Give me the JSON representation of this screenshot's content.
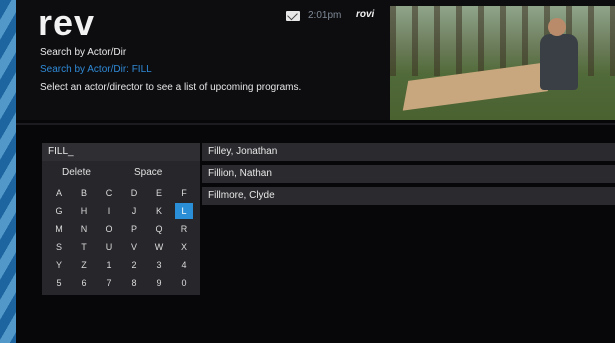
{
  "header": {
    "logo": "rev",
    "time": "2:01pm",
    "brand": "rovi"
  },
  "page": {
    "title": "Search by Actor/Dir",
    "subtitle": "Search by Actor/Dir: FILL",
    "instructions": "Select an actor/director to see a list of upcoming programs."
  },
  "keyboard": {
    "input_value": "FILL_",
    "delete_label": "Delete",
    "space_label": "Space",
    "selected_key": "L",
    "rows": [
      [
        "A",
        "B",
        "C",
        "D",
        "E",
        "F"
      ],
      [
        "G",
        "H",
        "I",
        "J",
        "K",
        "L"
      ],
      [
        "M",
        "N",
        "O",
        "P",
        "Q",
        "R"
      ],
      [
        "S",
        "T",
        "U",
        "V",
        "W",
        "X"
      ],
      [
        "Y",
        "Z",
        "1",
        "2",
        "3",
        "4"
      ],
      [
        "5",
        "6",
        "7",
        "8",
        "9",
        "0"
      ]
    ]
  },
  "results": [
    "Filley, Jonathan",
    "Fillion, Nathan",
    "Fillmore, Clyde"
  ],
  "colors": {
    "accent": "#2a8fd6",
    "background": "#07070a",
    "panel": "#26262b"
  }
}
